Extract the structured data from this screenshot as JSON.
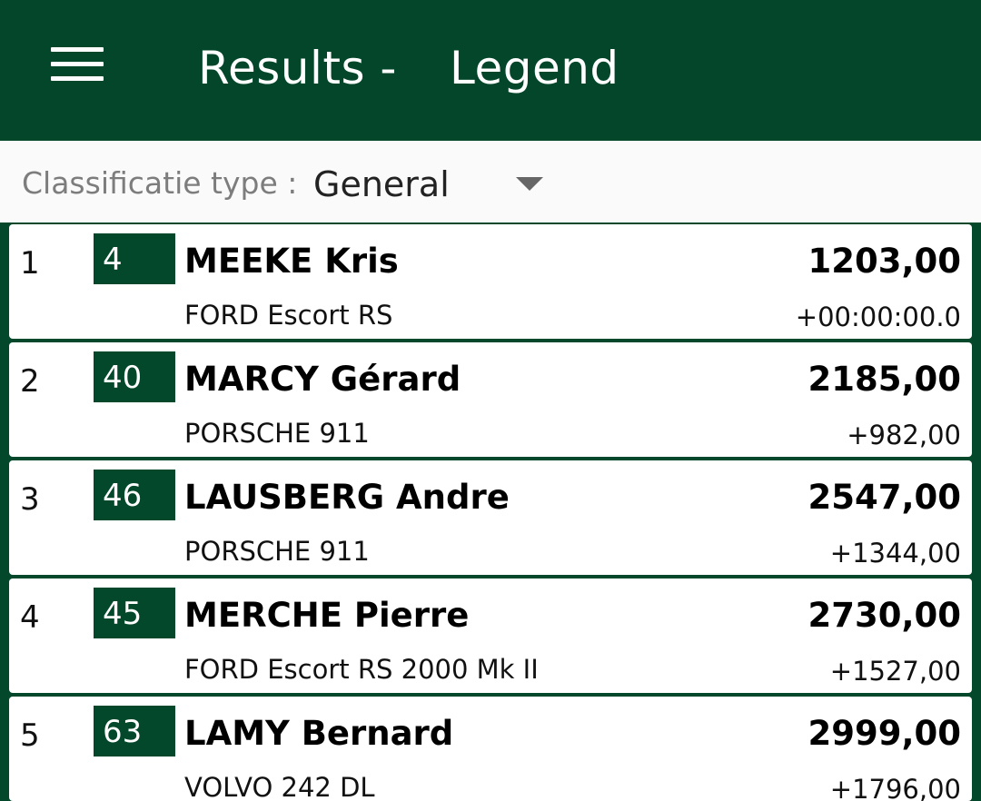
{
  "header": {
    "title_part1": "Results -",
    "title_part2": "Legend",
    "menu_icon": "hamburger-menu-icon",
    "background_color": "#03462a"
  },
  "filter": {
    "label": "Classificatie type :",
    "selected_value": "General",
    "dropdown_icon": "caret-down-icon"
  },
  "results": [
    {
      "position": "1",
      "number": "4",
      "driver": "MEEKE Kris",
      "points": "1203,00",
      "car": "FORD Escort RS",
      "difference": "+00:00:00.0"
    },
    {
      "position": "2",
      "number": "40",
      "driver": "MARCY Gérard",
      "points": "2185,00",
      "car": "PORSCHE 911",
      "difference": "+982,00"
    },
    {
      "position": "3",
      "number": "46",
      "driver": "LAUSBERG Andre",
      "points": "2547,00",
      "car": "PORSCHE 911",
      "difference": "+1344,00"
    },
    {
      "position": "4",
      "number": "45",
      "driver": "MERCHE Pierre",
      "points": "2730,00",
      "car": "FORD Escort RS 2000 Mk II",
      "difference": "+1527,00"
    },
    {
      "position": "5",
      "number": "63",
      "driver": "LAMY Bernard",
      "points": "2999,00",
      "car": "VOLVO 242 DL",
      "difference": "+1796,00"
    }
  ],
  "colors": {
    "brand_green": "#03482a",
    "card_background": "#ffffff",
    "filter_background": "#fafafa"
  }
}
